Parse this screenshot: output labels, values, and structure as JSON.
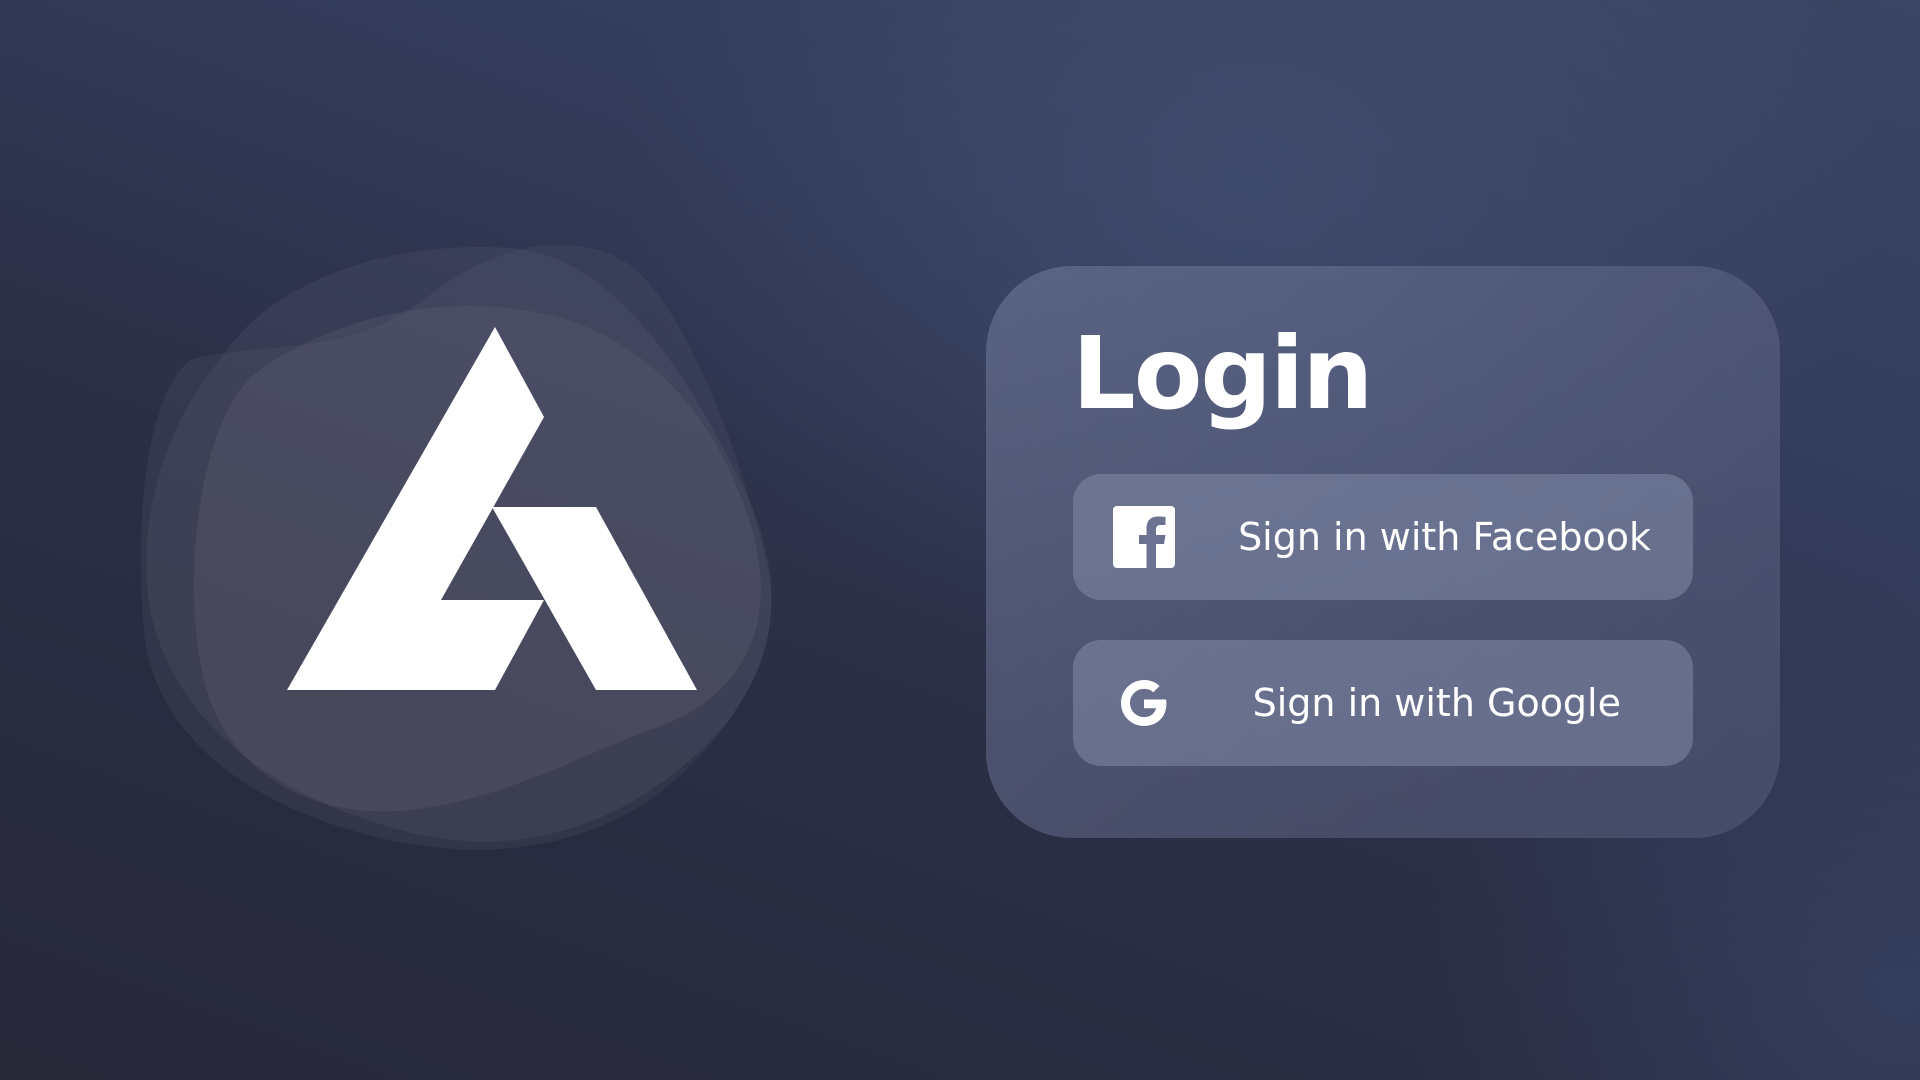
{
  "login": {
    "title": "Login",
    "buttons": [
      {
        "label": "Sign in with Facebook",
        "icon": "facebook-icon"
      },
      {
        "label": "Sign in with Google",
        "icon": "google-icon"
      }
    ]
  },
  "brand": {
    "logo_icon": "triangle-a-logo-icon",
    "logo_color": "#ffffff"
  },
  "colors": {
    "background_dark": "#262838",
    "background_light": "#3b4563",
    "card": "#5f6788",
    "button": "#6c7392",
    "text": "#ffffff"
  }
}
